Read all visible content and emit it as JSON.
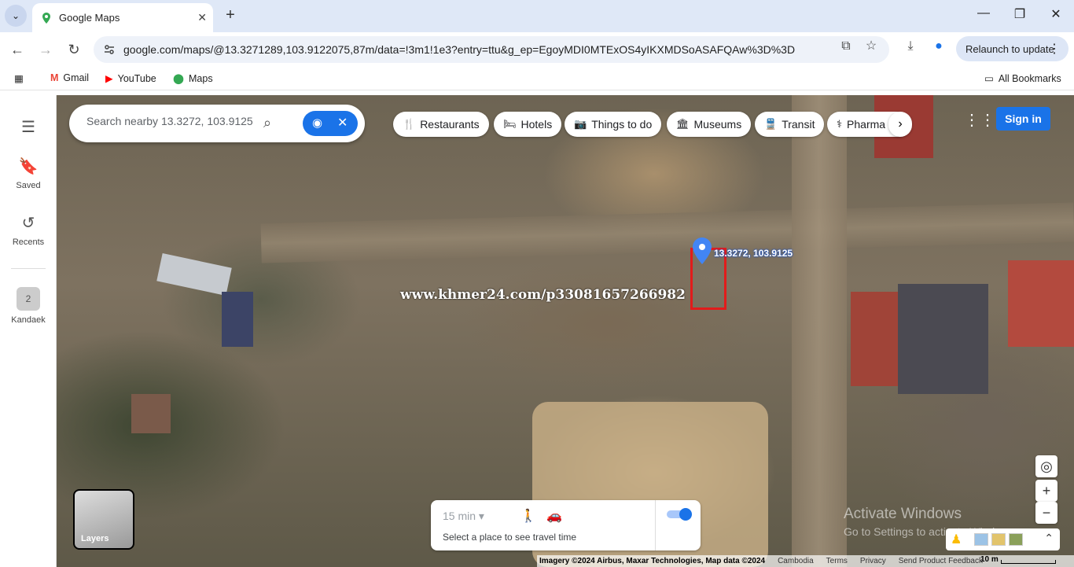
{
  "browser": {
    "tab_title": "Google Maps",
    "url": "google.com/maps/@13.3271289,103.9122075,87m/data=!3m1!1e3?entry=ttu&g_ep=EgoyMDI0MTExOS4yIKXMDSoASAFQAw%3D%3D",
    "relaunch_label": "Relaunch to update",
    "bookmarks": [
      {
        "label": "Gmail",
        "icon": "gmail-icon"
      },
      {
        "label": "YouTube",
        "icon": "youtube-icon"
      },
      {
        "label": "Maps",
        "icon": "maps-icon"
      }
    ],
    "all_bookmarks": "All Bookmarks"
  },
  "sidebar": {
    "items": [
      {
        "label": "Saved",
        "icon": "bookmark-icon"
      },
      {
        "label": "Recents",
        "icon": "history-icon"
      },
      {
        "label": "Kandaek",
        "icon": "place-icon"
      }
    ]
  },
  "search": {
    "placeholder": "Search nearby 13.3272, 103.9125"
  },
  "chips": [
    {
      "label": "Restaurants",
      "icon": "fork-knife-icon"
    },
    {
      "label": "Hotels",
      "icon": "bed-icon"
    },
    {
      "label": "Things to do",
      "icon": "camera-icon"
    },
    {
      "label": "Museums",
      "icon": "museum-icon"
    },
    {
      "label": "Transit",
      "icon": "train-icon"
    },
    {
      "label": "Pharma",
      "icon": "pharmacy-icon"
    }
  ],
  "sign_in": "Sign in",
  "map": {
    "pin_label": "13.3272, 103.9125",
    "watermark": "www.khmer24.com/p33081657266982",
    "layers_label": "Layers"
  },
  "travel": {
    "time_select": "15 min",
    "hint": "Select a place to see travel time"
  },
  "windows_notice": {
    "title": "Activate Windows",
    "subtitle": "Go to Settings to activate Windows."
  },
  "footer": {
    "imagery": "Imagery ©2024 Airbus, Maxar Technologies, Map data ©2024",
    "links": [
      "Cambodia",
      "Terms",
      "Privacy",
      "Send Product Feedback"
    ],
    "scale": "10 m"
  }
}
